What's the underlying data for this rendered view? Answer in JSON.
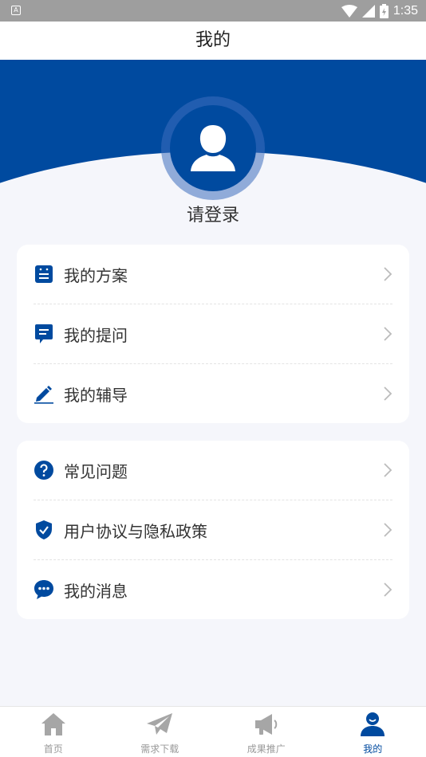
{
  "status_bar": {
    "time": "1:35",
    "notification_letter": "A"
  },
  "header": {
    "title": "我的"
  },
  "profile": {
    "login_text": "请登录"
  },
  "menu_group_1": [
    {
      "label": "我的方案",
      "icon": "plan-icon"
    },
    {
      "label": "我的提问",
      "icon": "question-message-icon"
    },
    {
      "label": "我的辅导",
      "icon": "pen-edit-icon"
    }
  ],
  "menu_group_2": [
    {
      "label": "常见问题",
      "icon": "help-circle-icon"
    },
    {
      "label": "用户协议与隐私政策",
      "icon": "shield-check-icon"
    },
    {
      "label": "我的消息",
      "icon": "chat-bubble-icon"
    }
  ],
  "tabs": [
    {
      "label": "首页",
      "icon": "home-icon",
      "active": false
    },
    {
      "label": "需求下载",
      "icon": "paper-plane-icon",
      "active": false
    },
    {
      "label": "成果推广",
      "icon": "megaphone-icon",
      "active": false
    },
    {
      "label": "我的",
      "icon": "user-icon",
      "active": true
    }
  ],
  "colors": {
    "primary": "#004a9f",
    "background": "#f5f6fb",
    "inactive": "#999999"
  }
}
